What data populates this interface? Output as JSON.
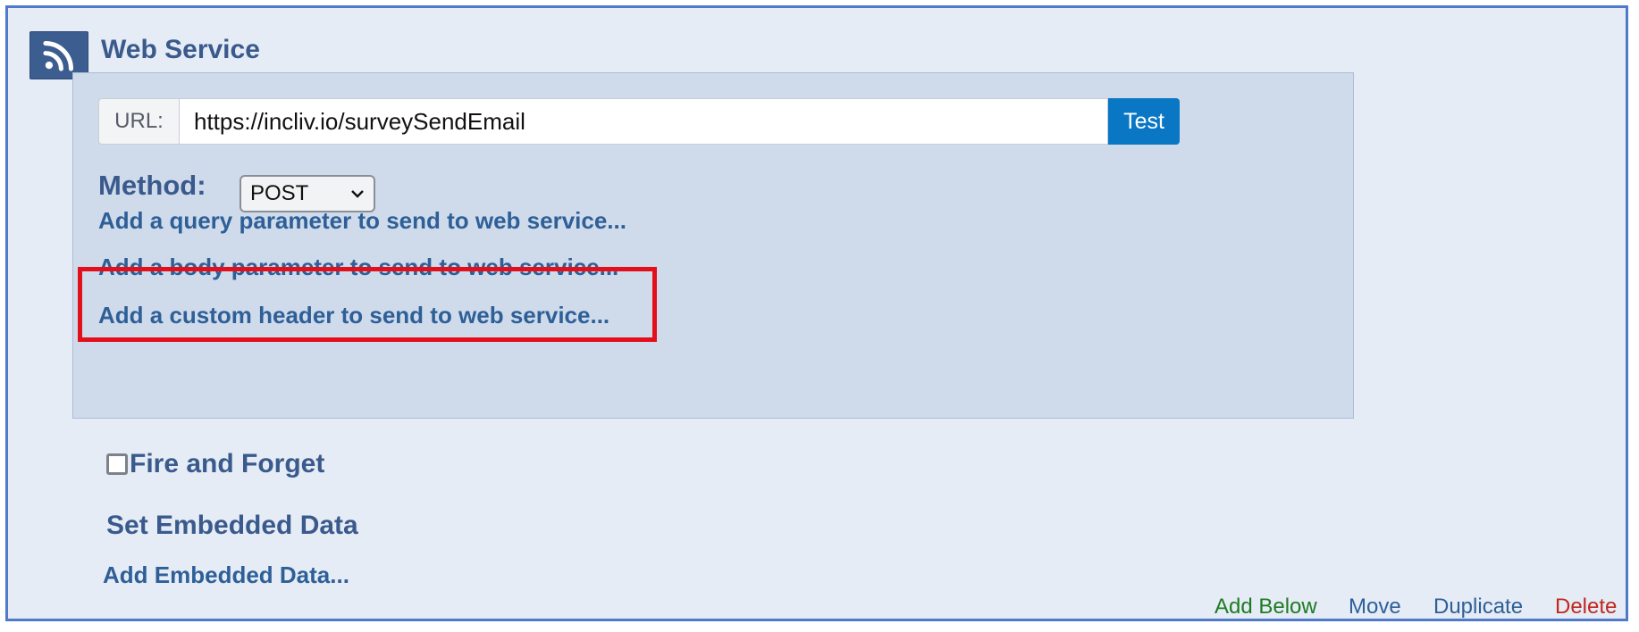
{
  "header": {
    "title": "Web Service",
    "icon": "rss-icon"
  },
  "url": {
    "label": "URL:",
    "value": "https://incliv.io/surveySendEmail",
    "test_label": "Test"
  },
  "method": {
    "label": "Method:",
    "selected": "POST"
  },
  "links": {
    "query": "Add a query parameter to send to web service...",
    "body": "Add a body parameter to send to web service...",
    "header": "Add a custom header to send to web service..."
  },
  "fire_and_forget": {
    "label": "Fire and Forget",
    "checked": false
  },
  "embedded": {
    "title": "Set Embedded Data",
    "add_link": "Add Embedded Data..."
  },
  "footer": {
    "add_below": "Add Below",
    "move": "Move",
    "duplicate": "Duplicate",
    "delete": "Delete"
  },
  "colors": {
    "accent": "#0a77c4",
    "title": "#3a5a8c",
    "link": "#2e5f97",
    "highlight": "#e3101b",
    "add_below": "#1e7b22",
    "delete": "#c0281e"
  }
}
